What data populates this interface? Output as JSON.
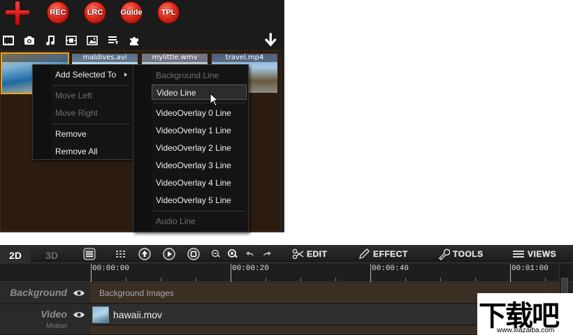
{
  "top_buttons": [
    "REC",
    "LRC",
    "Guide",
    "TPL"
  ],
  "media_icons": [
    "film-icon",
    "camera-icon",
    "music-icon",
    "video-icon",
    "image-icon",
    "text-icon",
    "puzzle-icon",
    "download-arrow-icon"
  ],
  "media_files": [
    "",
    "maldives.avi",
    "mylittle.wmv",
    "travel.mp4"
  ],
  "context_menu": {
    "add_selected_to": "Add Selected To",
    "move_left": "Move Left",
    "move_right": "Move Right",
    "remove": "Remove",
    "remove_all": "Remove All"
  },
  "submenu": {
    "items": [
      "Background Line",
      "Video Line",
      "VideoOverlay 0 Line",
      "VideoOverlay 1 Line",
      "VideoOverlay 2 Line",
      "VideoOverlay 3 Line",
      "VideoOverlay 4 Line",
      "VideoOverlay 5 Line",
      "Audio Line"
    ],
    "disabled": [
      "Background Line",
      "Audio Line"
    ],
    "highlighted": "Video Line"
  },
  "editor": {
    "mode_2d": "2D",
    "mode_3d": "3D",
    "edit_label": "EDIT",
    "effect_label": "EFFECT",
    "tools_label": "TOOLS",
    "views_label": "VIEWS",
    "ruler_ticks": [
      "00:00:00",
      "00:00:20",
      "00:00:40",
      "00:01:00"
    ],
    "tracks": {
      "background": {
        "label": "Background",
        "content": "Background Images"
      },
      "video": {
        "label": "Video",
        "sub": "Motion",
        "clip": "hawaii.mov"
      }
    }
  },
  "watermark": {
    "logo": "下载吧",
    "url": "www.xiazaiba.com"
  },
  "colors": {
    "accent_red": "#e02a1a",
    "selection": "#e9a21f",
    "media_bg": "#2b1c0f"
  }
}
